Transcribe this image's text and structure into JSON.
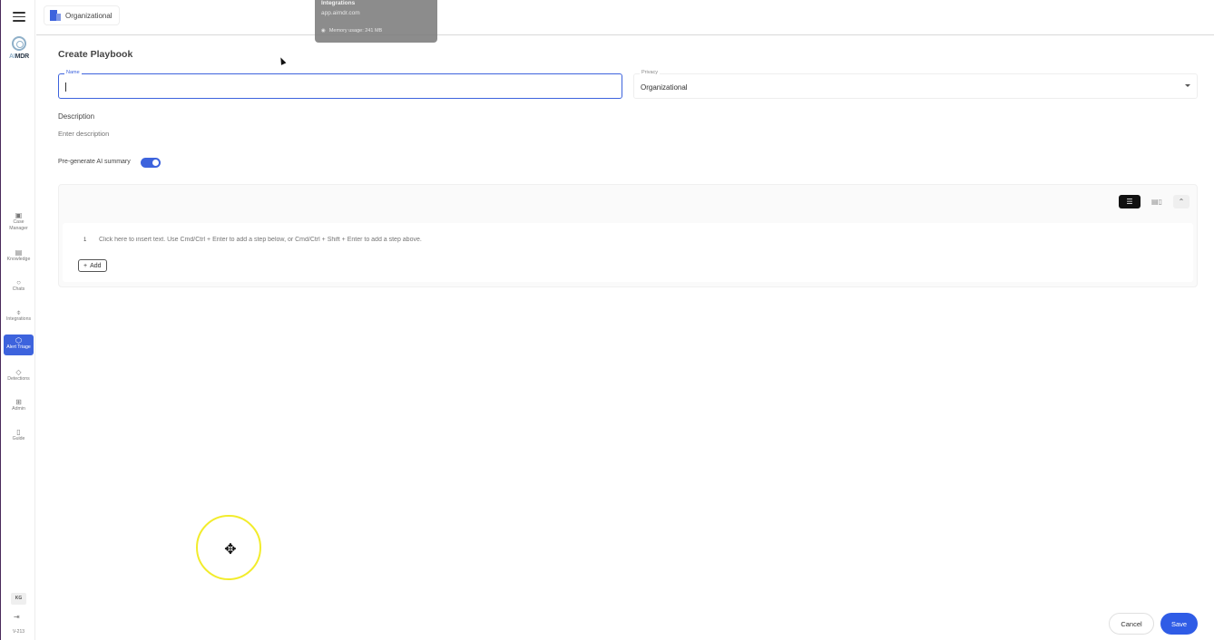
{
  "rail": {
    "logo_prefix": "AI",
    "logo_suffix": "MDR",
    "items": [
      {
        "label_line1": "Case",
        "label_line2": "Manager",
        "icon": "briefcase-icon"
      },
      {
        "label": "Knowledge",
        "icon": "document-icon"
      },
      {
        "label": "Chats",
        "icon": "chat-bubble-icon"
      },
      {
        "label": "Integrations",
        "icon": "plug-icon"
      },
      {
        "label": "Alert Triage",
        "icon": "cube-icon",
        "active": true
      },
      {
        "label": "Detections",
        "icon": "shield-icon"
      },
      {
        "label": "Admin",
        "icon": "grid-icon"
      },
      {
        "label": "Guide",
        "icon": "book-icon"
      }
    ],
    "user_initials": "KG",
    "version": "V-213"
  },
  "topbar": {
    "org_label": "Organizational"
  },
  "tooltip": {
    "title": "Integrations",
    "url": "app.aimdr.com",
    "memory": "Memory usage: 241 MB"
  },
  "form": {
    "page_title": "Create Playbook",
    "name_label": "Name",
    "name_value": "",
    "privacy_label": "Privacy",
    "privacy_value": "Organizational",
    "description_label": "Description",
    "description_placeholder": "Enter description",
    "ai_summary_label": "Pre-generate AI summary",
    "ai_summary_enabled": true
  },
  "editor": {
    "step_number": "1",
    "step_placeholder": "Click here to insert text. Use Cmd/Ctrl + Enter to add a step below, or Cmd/Ctrl + Shift + Enter to add a step above.",
    "add_label": "Add"
  },
  "footer": {
    "cancel_label": "Cancel",
    "save_label": "Save"
  },
  "colors": {
    "accent": "#3d63dd",
    "save": "#2f5ce6",
    "spotlight": "#f2ec2c"
  }
}
